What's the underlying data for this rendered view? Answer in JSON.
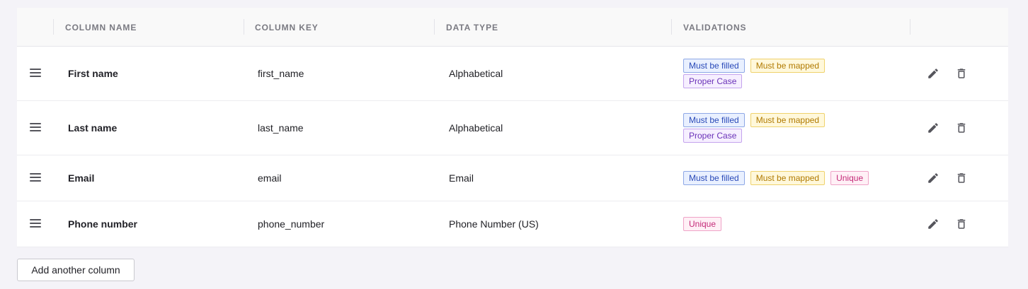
{
  "header": {
    "column_name": "Column name",
    "column_key": "Column key",
    "data_type": "Data type",
    "validations": "Validations"
  },
  "rows": [
    {
      "name": "First name",
      "key": "first_name",
      "type": "Alphabetical",
      "validations": [
        [
          "Must be filled",
          "Must be mapped"
        ],
        [
          "Proper Case"
        ]
      ]
    },
    {
      "name": "Last name",
      "key": "last_name",
      "type": "Alphabetical",
      "validations": [
        [
          "Must be filled",
          "Must be mapped"
        ],
        [
          "Proper Case"
        ]
      ]
    },
    {
      "name": "Email",
      "key": "email",
      "type": "Email",
      "validations": [
        [
          "Must be filled",
          "Must be mapped",
          "Unique"
        ]
      ]
    },
    {
      "name": "Phone number",
      "key": "phone_number",
      "type": "Phone Number (US)",
      "validations": [
        [
          "Unique"
        ]
      ]
    }
  ],
  "icons": {
    "drag": "drag-handle-icon",
    "edit": "pencil-icon",
    "delete": "trash-icon"
  },
  "tag_colors": {
    "Must be filled": "#2a4ab8",
    "Must be mapped": "#b07a00",
    "Proper Case": "#6a32b8",
    "Unique": "#c42a78"
  },
  "add_button_label": "Add another column"
}
